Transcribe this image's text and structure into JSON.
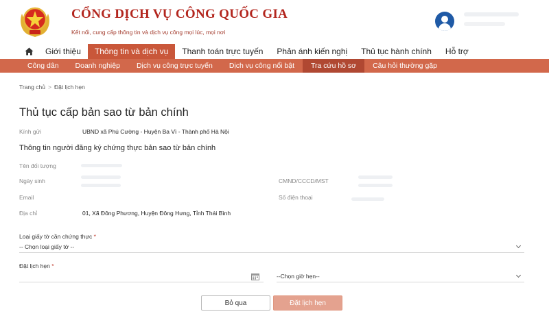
{
  "header": {
    "title": "CỔNG DỊCH VỤ CÔNG QUỐC GIA",
    "subtitle": "Kết nối, cung cấp thông tin và dịch vụ công mọi lúc, mọi nơi",
    "emblem_icon": "national-emblem-icon",
    "avatar_icon": "user-avatar-icon"
  },
  "colors": {
    "brand": "#b3261e",
    "nav_active": "#c9573a",
    "subnav_bg": "#d2684b",
    "subnav_active": "#b04832",
    "primary_button": "#e4a28f"
  },
  "mainnav": {
    "home_icon": "home-icon",
    "items": [
      {
        "label": "Giới thiệu",
        "active": false
      },
      {
        "label": "Thông tin và dịch vụ",
        "active": true
      },
      {
        "label": "Thanh toán trực tuyến",
        "active": false
      },
      {
        "label": "Phản ánh kiến nghị",
        "active": false
      },
      {
        "label": "Thủ tục hành chính",
        "active": false
      },
      {
        "label": "Hỗ trợ",
        "active": false
      }
    ]
  },
  "subnav": {
    "items": [
      {
        "label": "Công dân",
        "active": false
      },
      {
        "label": "Doanh nghiệp",
        "active": false
      },
      {
        "label": "Dịch vụ công trực tuyến",
        "active": false
      },
      {
        "label": "Dịch vụ công nổi bật",
        "active": false
      },
      {
        "label": "Tra cứu hồ sơ",
        "active": true
      },
      {
        "label": "Câu hỏi thường gặp",
        "active": false
      }
    ]
  },
  "breadcrumb": {
    "home": "Trang chủ",
    "separator": ">",
    "current": "Đặt lịch hẹn"
  },
  "page": {
    "title": "Thủ tục cấp bản sao từ bản chính",
    "recipient_label": "Kính gửi",
    "recipient_value": "UBND xã Phú Cường - Huyện Ba Vì - Thành phố Hà Nội",
    "section_title": "Thông tin người đăng ký chứng thực bản sao từ bản chính"
  },
  "applicant": {
    "name_label": "Tên đối tượng",
    "dob_label": "Ngày sinh",
    "email_label": "Email",
    "address_label": "Địa chỉ",
    "address_value": "01, Xã Đông Phương, Huyện Đông Hưng, Tỉnh Thái Bình",
    "id_label": "CMND/CCCD/MST",
    "phone_label": "Số điện thoại"
  },
  "form": {
    "doc_type_label": "Loại giấy tờ cần chứng thực",
    "doc_type_placeholder": "-- Chọn loại giấy tờ --",
    "appointment_label": "Đặt lịch hẹn",
    "time_placeholder": "--Chọn giờ hẹn--",
    "required_mark": "*",
    "calendar_icon": "calendar-icon",
    "chevron_icon": "chevron-down-icon"
  },
  "buttons": {
    "cancel": "Bỏ qua",
    "submit": "Đặt lịch hẹn"
  }
}
